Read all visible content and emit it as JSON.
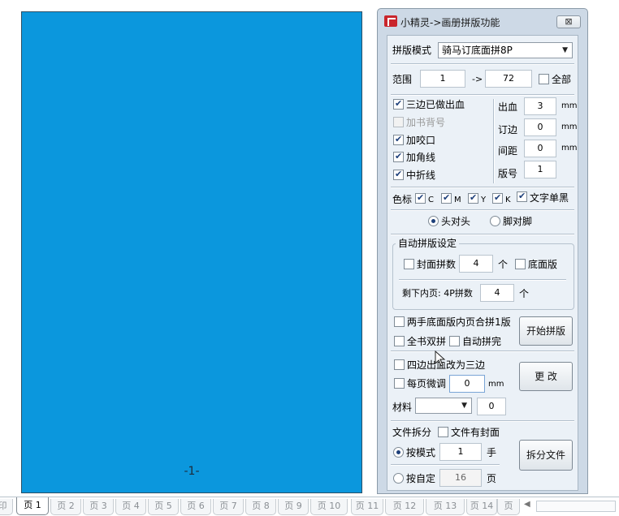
{
  "document": {
    "page_number": "-1-"
  },
  "panel": {
    "title": "小精灵->画册拼版功能",
    "close_label": "⊠",
    "imposition_mode": {
      "label": "拼版模式",
      "value": "骑马订底面拼8P"
    },
    "range": {
      "label": "范围",
      "from": "1",
      "arrow": "->",
      "to": "72",
      "all_label": "全部"
    },
    "options": {
      "bleed_done": "三边已做出血",
      "add_spine_no": "加书背号",
      "add_bite": "加咬口",
      "add_corner": "加角线",
      "center_fold": "中折线"
    },
    "params": {
      "bleed_label": "出血",
      "bleed_value": "3",
      "bleed_unit": "mm",
      "binding_label": "订边",
      "binding_value": "0",
      "binding_unit": "mm",
      "spacing_label": "间距",
      "spacing_value": "0",
      "spacing_unit": "mm",
      "plate_label": "版号",
      "plate_value": "1"
    },
    "color_marks": {
      "label": "色标",
      "c": "C",
      "m": "M",
      "y": "Y",
      "k": "K",
      "text_black": "文字单黑"
    },
    "orientation": {
      "head_to_head": "头对头",
      "foot_to_foot": "脚对脚"
    },
    "auto": {
      "group_title": "自动拼版设定",
      "cover_count_label": "封面拼数",
      "cover_count_value": "4",
      "cover_unit": "个",
      "bottom_plate_label": "底面版",
      "remaining_label": "剩下内页: 4P拼数",
      "remaining_value": "4",
      "remaining_unit": "个"
    },
    "merge": {
      "two_hand": "两手底面版内页合拼1版",
      "full_double": "全书双拼",
      "auto_finish": "自动拼完",
      "start_button": "开始拼版"
    },
    "modify": {
      "four_to_three": "四边出血改为三边",
      "fine_tune_label": "每页微调",
      "fine_tune_value": "0",
      "fine_tune_unit": "mm",
      "material_label": "材料",
      "material_value": "",
      "material_num": "0",
      "change_button": "更 改"
    },
    "split": {
      "label": "文件拆分",
      "has_cover": "文件有封面",
      "by_mode_label": "按模式",
      "by_mode_value": "1",
      "by_mode_unit": "手",
      "by_custom_label": "按自定",
      "by_custom_value": "16",
      "by_custom_unit": "页",
      "split_button": "拆分文件"
    }
  },
  "tabs": {
    "first_partial": "印",
    "items": [
      "页 1",
      "页 2",
      "页 3",
      "页 4",
      "页 5",
      "页 6",
      "页 7",
      "页 8",
      "页 9",
      "页 10",
      "页 11",
      "页 12",
      "页 13",
      "页 14",
      "页"
    ]
  }
}
